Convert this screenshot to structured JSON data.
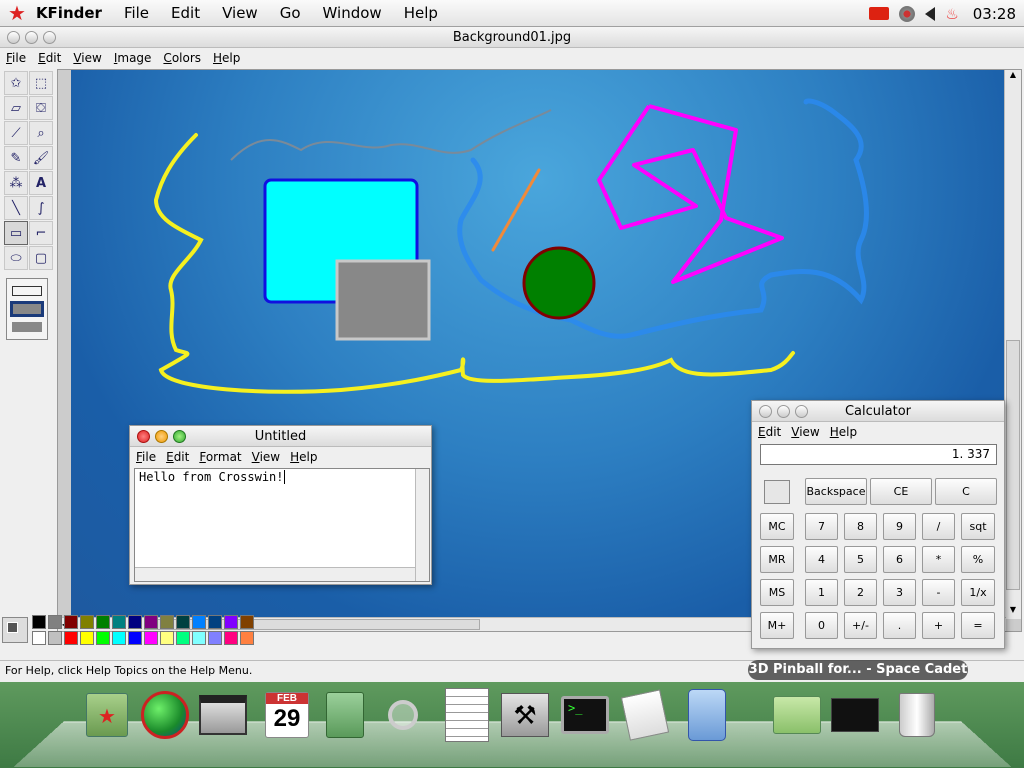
{
  "menubar": {
    "app_name": "KFinder",
    "items": [
      "File",
      "Edit",
      "View",
      "Go",
      "Window",
      "Help"
    ],
    "clock": "03:28"
  },
  "paint": {
    "title": "Background01.jpg",
    "menu": [
      "File",
      "Edit",
      "View",
      "Image",
      "Colors",
      "Help"
    ],
    "status": "For Help, click Help Topics on the Help Menu.",
    "palette_top": [
      "#000000",
      "#808080",
      "#800000",
      "#808000",
      "#008000",
      "#008080",
      "#000080",
      "#800080",
      "#808040",
      "#004040",
      "#0080ff",
      "#004080",
      "#8000ff",
      "#804000"
    ],
    "palette_bottom": [
      "#ffffff",
      "#c0c0c0",
      "#ff0000",
      "#ffff00",
      "#00ff00",
      "#00ffff",
      "#0000ff",
      "#ff00ff",
      "#ffff80",
      "#00ff80",
      "#80ffff",
      "#8080ff",
      "#ff0080",
      "#ff8040"
    ]
  },
  "notepad": {
    "title": "Untitled",
    "menu": [
      "File",
      "Edit",
      "Format",
      "View",
      "Help"
    ],
    "text": "Hello from Crosswin!"
  },
  "calculator": {
    "title": "Calculator",
    "menu": [
      "Edit",
      "View",
      "Help"
    ],
    "display": "1. 337",
    "top_buttons": [
      "Backspace",
      "CE",
      "C"
    ],
    "rows": [
      [
        "MC",
        "7",
        "8",
        "9",
        "/",
        "sqt"
      ],
      [
        "MR",
        "4",
        "5",
        "6",
        "*",
        "%"
      ],
      [
        "MS",
        "1",
        "2",
        "3",
        "-",
        "1/x"
      ],
      [
        "M+",
        "0",
        "+/-",
        ".",
        "+",
        "="
      ]
    ]
  },
  "dock": {
    "tooltip": "3D Pinball for... - Space Cadet",
    "calendar_month": "FEB",
    "calendar_day": "29"
  }
}
